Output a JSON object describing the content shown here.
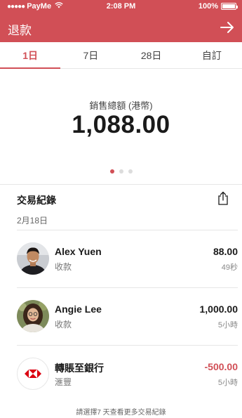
{
  "status_bar": {
    "carrier": "PayMe",
    "time": "2:08 PM",
    "battery": "100%"
  },
  "header": {
    "title": "退款",
    "action_icon": "arrow-right-icon"
  },
  "tabs": [
    {
      "label": "1日",
      "active": true
    },
    {
      "label": "7日",
      "active": false
    },
    {
      "label": "28日",
      "active": false
    },
    {
      "label": "自訂",
      "active": false
    }
  ],
  "summary": {
    "label": "銷售總額 (港幣)",
    "value": "1,088.00",
    "page_count": 3,
    "current_page": 1
  },
  "transactions": {
    "title": "交易紀錄",
    "date": "2月18日",
    "items": [
      {
        "name": "Alex Yuen",
        "type": "收款",
        "amount": "88.00",
        "time": "49秒",
        "avatar": "person-avatar",
        "negative": false
      },
      {
        "name": "Angie Lee",
        "type": "收款",
        "amount": "1,000.00",
        "time": "5小時",
        "avatar": "person-avatar",
        "negative": false
      },
      {
        "name": "轉賬至銀行",
        "type": "滙豐",
        "amount": "-500.00",
        "time": "5小時",
        "avatar": "hsbc-logo",
        "negative": true
      }
    ],
    "footer": "請選擇7 天查看更多交易紀錄"
  },
  "colors": {
    "brand": "#d14f56",
    "text": "#1a1a1a",
    "muted": "#777777",
    "divider": "#e6e6e6"
  }
}
